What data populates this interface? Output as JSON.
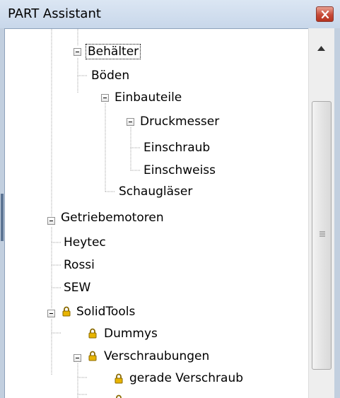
{
  "window": {
    "title": "PART Assistant"
  },
  "tree": {
    "items": [
      {
        "label": "Behälter",
        "locked": false
      },
      {
        "label": "Böden",
        "locked": false
      },
      {
        "label": "Einbauteile",
        "locked": false
      },
      {
        "label": "Druckmesser",
        "locked": false
      },
      {
        "label": "Einschraub",
        "locked": false
      },
      {
        "label": "Einschweiss",
        "locked": false
      },
      {
        "label": "Schaugläser",
        "locked": false
      },
      {
        "label": "Getriebemotoren",
        "locked": false
      },
      {
        "label": "Heytec",
        "locked": false
      },
      {
        "label": "Rossi",
        "locked": false
      },
      {
        "label": "SEW",
        "locked": false
      },
      {
        "label": "SolidTools",
        "locked": true
      },
      {
        "label": "Dummys",
        "locked": true
      },
      {
        "label": "Verschraubungen",
        "locked": true
      },
      {
        "label": "gerade Verschraub",
        "locked": true
      }
    ]
  },
  "colors": {
    "lock": "#d9a400",
    "close_button": "#c74a38"
  }
}
